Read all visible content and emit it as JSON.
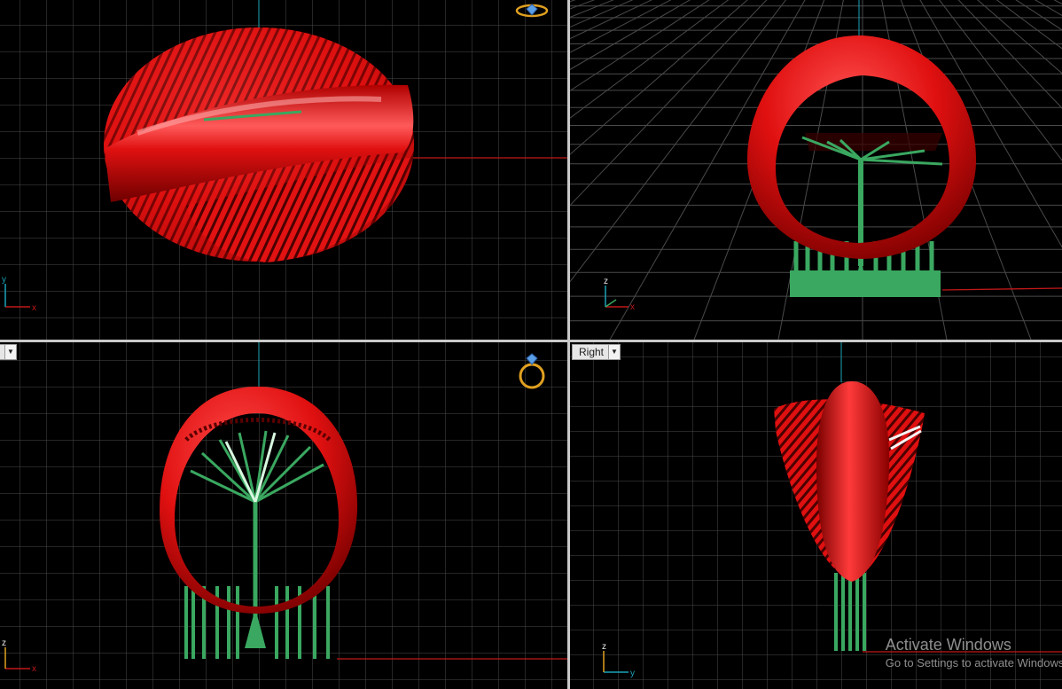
{
  "viewports": {
    "top_left": {
      "axis_a": "y",
      "axis_b": "x"
    },
    "top_right": {
      "axis_a": "z",
      "axis_b": "x"
    },
    "bottom_left": {
      "axis_a": "z",
      "axis_b": "x"
    },
    "bottom_right": {
      "label": "Right",
      "axis_a": "z",
      "axis_b": "y"
    }
  },
  "watermark": {
    "line1": "Activate Windows",
    "line2": "Go to Settings to activate Windows."
  },
  "colors": {
    "background": "#000000",
    "grid": "#4a4a4a",
    "axis_x": "#c01818",
    "axis_y": "#1aa3b8",
    "ring": "#e01010",
    "ring_dark": "#8a0000",
    "support": "#3aa860",
    "support_light": "#a8f0b8"
  },
  "icons": [
    "ring-view-cube-icon",
    "dropdown-arrow-icon"
  ]
}
